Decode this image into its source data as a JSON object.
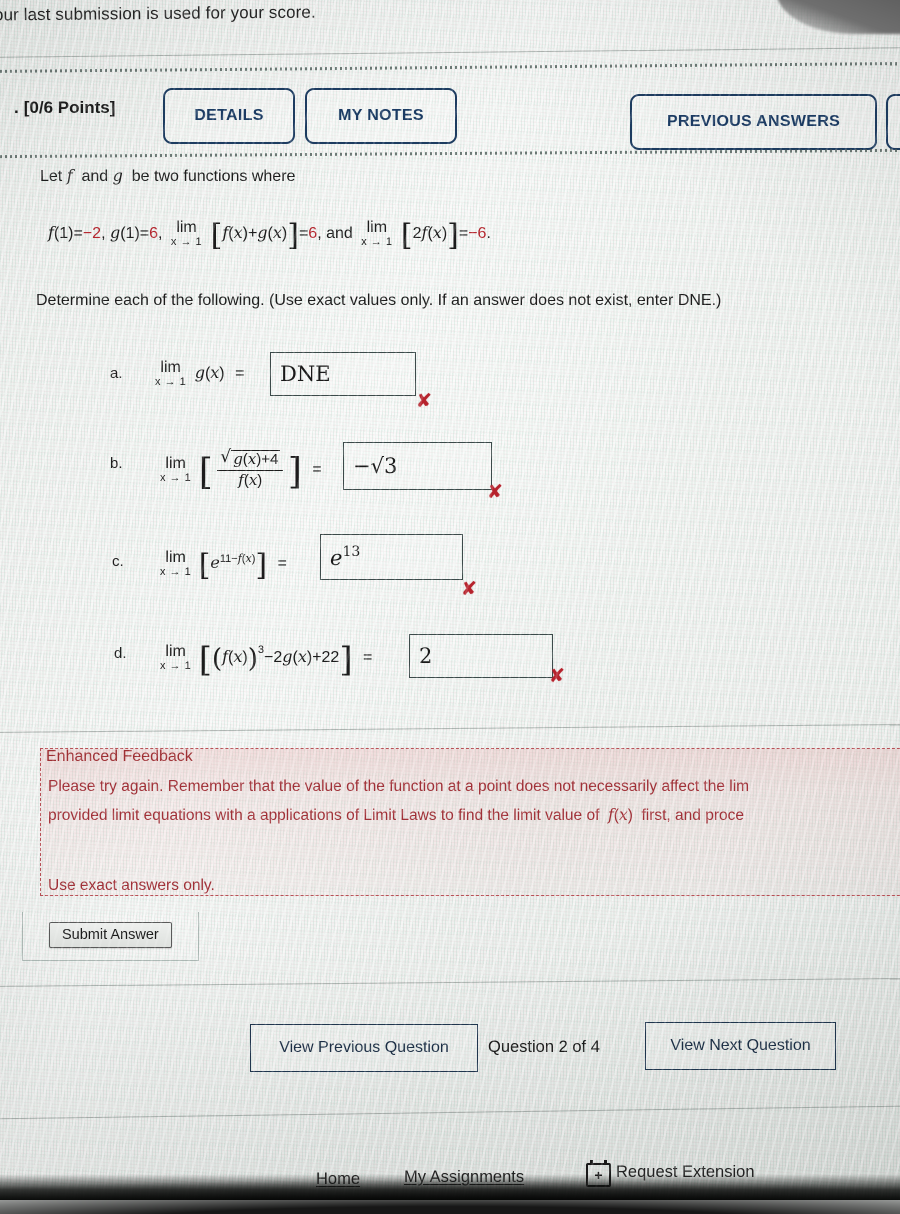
{
  "banner": {
    "note": "our last submission is used for your score."
  },
  "header": {
    "points": "[0/6 Points]",
    "bullet": ".",
    "details_label": "DETAILS",
    "my_notes_label": "MY NOTES",
    "previous_answers_label": "PREVIOUS ANSWERS",
    "accent_color": "#1d3c60"
  },
  "question": {
    "intro": "Let f and g be two functions where",
    "given": {
      "f1": "f(1)=−2,",
      "g1": "g(1)=6,",
      "lim_word": "lim",
      "lim_sub": "x → 1",
      "expr1": "f(x)+g(x)",
      "eq1": "=6, and",
      "expr2": "2f(x)",
      "eq2": "=−6."
    },
    "instruction": "Determine each of the following. (Use exact values only. If an answer does not exist, enter DNE.)"
  },
  "items": [
    {
      "label": "a.",
      "lim_word": "lim",
      "lim_sub": "x → 1",
      "expr": "g(x)",
      "equals": "=",
      "answer": "DNE",
      "status": "incorrect",
      "status_mark": "✘"
    },
    {
      "label": "b.",
      "lim_word": "lim",
      "lim_sub": "x → 1",
      "numerator": "g(x)+4",
      "denominator": "f(x)",
      "equals": "=",
      "answer": "−√3",
      "status": "incorrect",
      "status_mark": "✘"
    },
    {
      "label": "c.",
      "lim_word": "lim",
      "lim_sub": "x → 1",
      "base": "e",
      "exponent": "11−f(x)",
      "equals": "=",
      "answer_base": "e",
      "answer_exp": "13",
      "status": "incorrect",
      "status_mark": "✘"
    },
    {
      "label": "d.",
      "lim_word": "lim",
      "lim_sub": "x → 1",
      "expr_a": "f(x)",
      "expr_pow": "3",
      "expr_b": "−2g(x)+22",
      "equals": "=",
      "answer": "2",
      "status": "incorrect",
      "status_mark": "✘"
    }
  ],
  "feedback": {
    "title": "Enhanced Feedback",
    "line1": "Please try again. Remember that the value of the function at a point does not necessarily affect the lim",
    "line2": "provided limit equations with a applications of Limit Laws to find the limit value of  f(x)  first, and proce",
    "line3": "Use exact answers only.",
    "color": "#a03037"
  },
  "submit": {
    "label": "Submit Answer"
  },
  "pager": {
    "prev_label": "View Previous Question",
    "count_label": "Question 2 of 4",
    "next_label": "View Next Question"
  },
  "footer": {
    "home": "Home",
    "my_assignments": "My Assignments",
    "request_extension": "Request Extension",
    "extension_icon_glyph": "+"
  }
}
